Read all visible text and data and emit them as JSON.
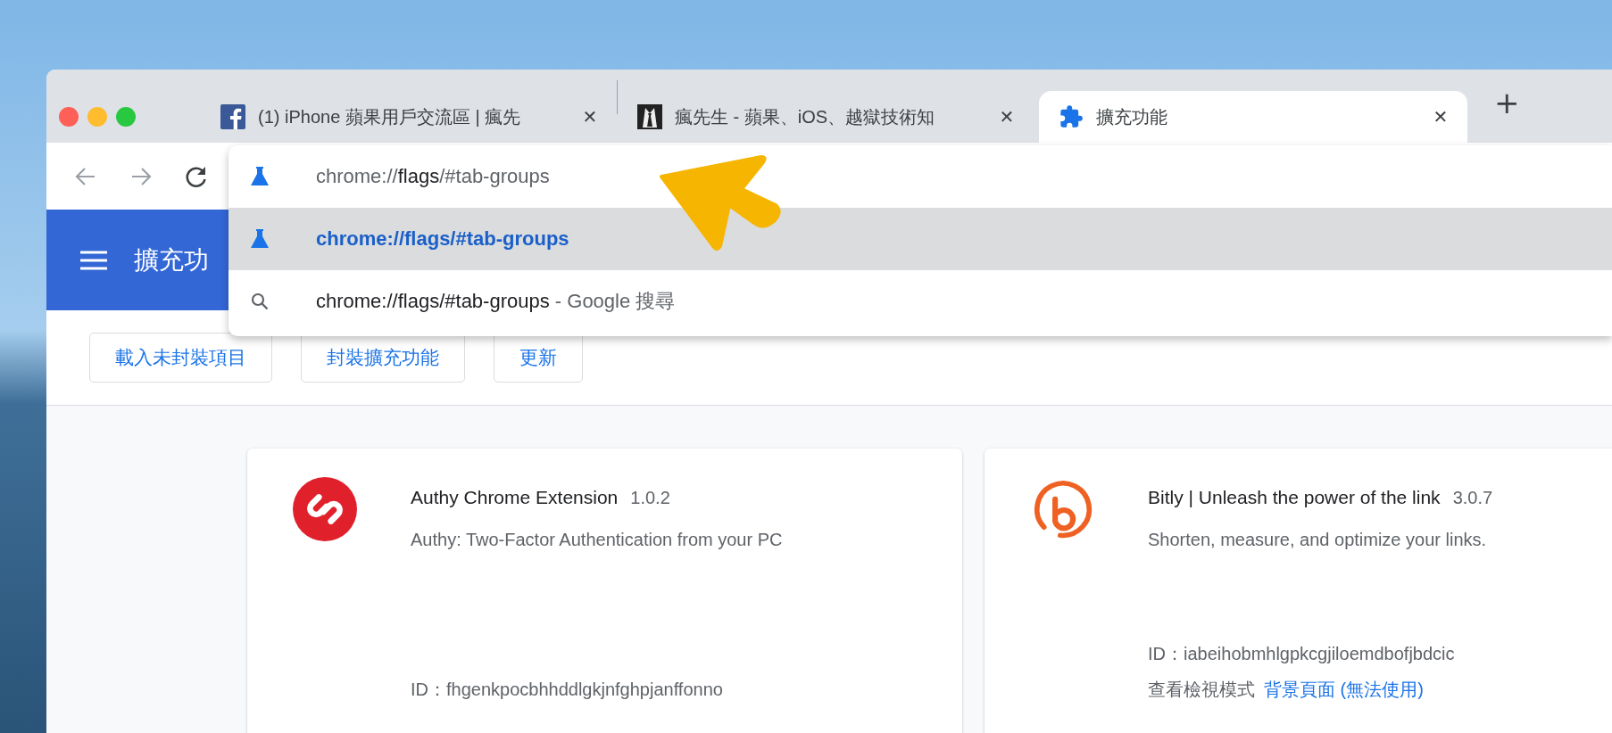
{
  "tabs": [
    {
      "kind": "facebook",
      "title": "(1) iPhone 蘋果用戶交流區 | 瘋先",
      "close": "✕",
      "selected": false
    },
    {
      "kind": "suit",
      "title": "瘋先生 - 蘋果、iOS、越獄技術知",
      "close": "✕",
      "selected": false
    },
    {
      "kind": "puzzle",
      "title": "擴充功能",
      "close": "✕",
      "selected": true
    }
  ],
  "new_tab": "+",
  "omnibox": {
    "value": [
      {
        "text": "chrome://",
        "emphasis": false
      },
      {
        "text": "flags",
        "emphasis": true
      },
      {
        "text": "/#tab-groups",
        "emphasis": false
      }
    ],
    "suggestions": [
      {
        "kind": "flag",
        "text": "chrome://flags/#tab-groups",
        "selected": true
      },
      {
        "kind": "search",
        "text": "chrome://flags/#tab-groups",
        "description": "- Google 搜尋",
        "selected": false
      }
    ]
  },
  "header": {
    "title": "擴充功"
  },
  "buttons": [
    "載入未封裝項目",
    "封裝擴充功能",
    "更新"
  ],
  "extensions": [
    {
      "kind": "authy",
      "name": "Authy Chrome Extension",
      "version": "1.0.2",
      "description": "Authy: Two-Factor Authentication from your PC",
      "id": "ID：fhgenkpocbhhddlgkjnfghpjanffonno"
    },
    {
      "kind": "bitly",
      "name": "Bitly | Unleash the power of the link",
      "version": "3.0.7",
      "description": "Shorten, measure, and optimize your links.",
      "id": "ID：iabeihobmhlgpkcgjiloemdbofjbdcic",
      "views_label": "查看檢視模式",
      "views_link": "背景頁面 (無法使用)"
    }
  ]
}
